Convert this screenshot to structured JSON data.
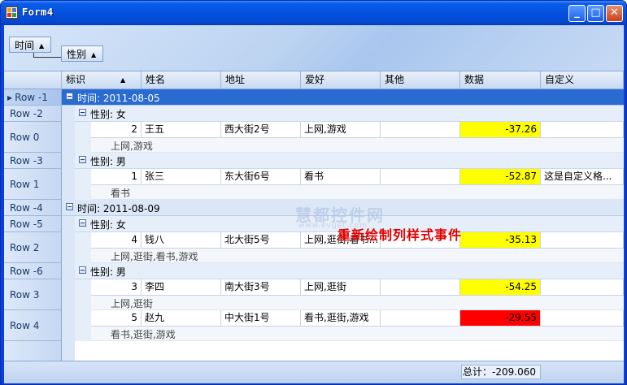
{
  "window": {
    "title": "Form4"
  },
  "groupby": [
    {
      "label": "时间",
      "sort": "asc"
    },
    {
      "label": "性别",
      "sort": "asc"
    }
  ],
  "columns": [
    {
      "label": "标识",
      "sorted": "asc"
    },
    {
      "label": "姓名"
    },
    {
      "label": "地址"
    },
    {
      "label": "爱好"
    },
    {
      "label": "其他"
    },
    {
      "label": "数据"
    },
    {
      "label": "自定义"
    }
  ],
  "row_headers": [
    "Row -1",
    "Row -2",
    "Row 0",
    "Row -3",
    "Row 1",
    "Row -4",
    "Row -5",
    "Row 2",
    "Row -6",
    "Row 3",
    "Row 4"
  ],
  "groups": [
    {
      "label": "时间: 2011-08-05",
      "subgroups": [
        {
          "label": "性别: 女",
          "rows": [
            {
              "id": "2",
              "name": "王五",
              "address": "西大街2号",
              "hobby": "上网,游戏",
              "other": "",
              "data": "-37.26",
              "data_color": "#ffff00",
              "custom": "",
              "preview": "上网,游戏"
            }
          ]
        },
        {
          "label": "性别: 男",
          "rows": [
            {
              "id": "1",
              "name": "张三",
              "address": "东大街6号",
              "hobby": "看书",
              "other": "",
              "data": "-52.87",
              "data_color": "#ffff00",
              "custom": "这是自定义格...",
              "preview": "看书"
            }
          ]
        }
      ]
    },
    {
      "label": "时间: 2011-08-09",
      "subgroups": [
        {
          "label": "性别: 女",
          "rows": [
            {
              "id": "4",
              "name": "钱八",
              "address": "北大街5号",
              "hobby": "上网,逛街,看书...",
              "other": "",
              "data": "-35.13",
              "data_color": "#ffff00",
              "custom": "",
              "preview": "上网,逛街,看书,游戏"
            }
          ]
        },
        {
          "label": "性别: 男",
          "rows": [
            {
              "id": "3",
              "name": "李四",
              "address": "南大街3号",
              "hobby": "上网,逛街",
              "other": "",
              "data": "-54.25",
              "data_color": "#ffff00",
              "custom": "",
              "preview": "上网,逛街"
            },
            {
              "id": "5",
              "name": "赵九",
              "address": "中大街1号",
              "hobby": "看书,逛街,游戏",
              "other": "",
              "data": "-29.55",
              "data_color": "#ff0000",
              "custom": "",
              "preview": "看书,逛街,游戏"
            }
          ]
        }
      ]
    }
  ],
  "caption": "重新绘制列样式事件",
  "watermark": {
    "text": "慧都控件网",
    "sub": "www.evget.com"
  },
  "footer": {
    "total": "总计：-209.060"
  }
}
